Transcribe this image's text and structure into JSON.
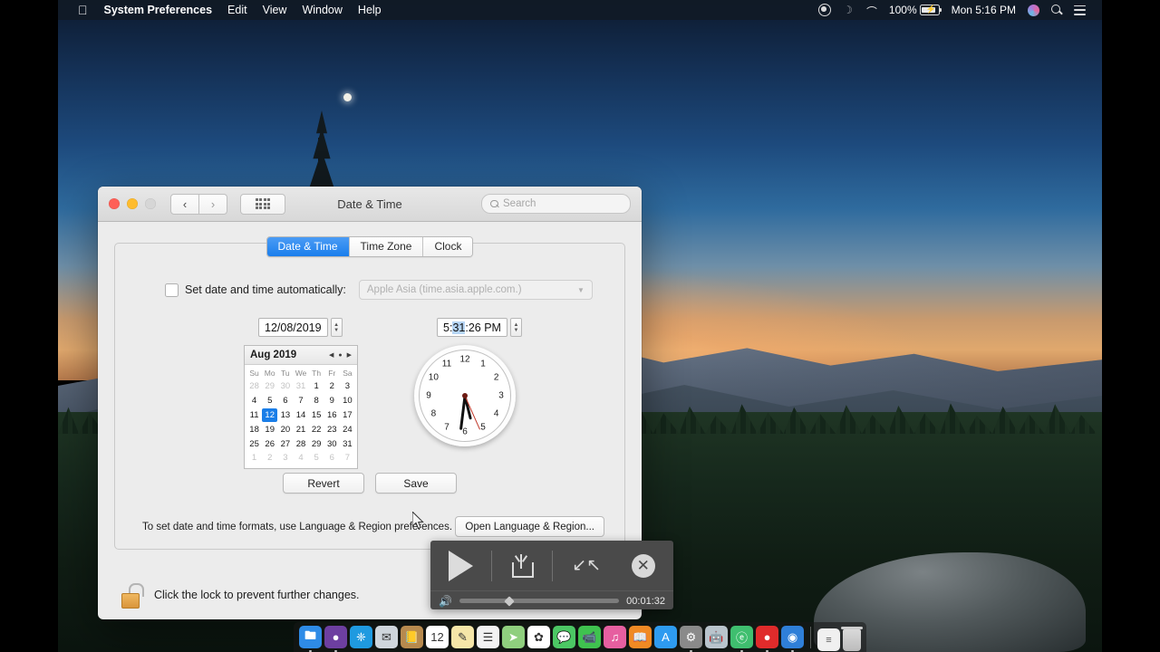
{
  "menubar": {
    "apple_logo": "",
    "items": [
      "System Preferences",
      "Edit",
      "View",
      "Window",
      "Help"
    ],
    "status": {
      "record_icon": "record-icon",
      "bluetooth_icon": "bluetooth-icon",
      "wifi_icon": "wifi-icon",
      "battery_percent": "100%",
      "clock": "Mon 5:16 PM",
      "siri_icon": "siri-icon",
      "search_icon": "spotlight-search-icon",
      "notification_icon": "notification-center-icon"
    }
  },
  "window": {
    "title": "Date & Time",
    "traffic_lights": [
      "close",
      "minimize",
      "zoom"
    ],
    "back_label": "‹",
    "forward_label": "›",
    "grid_button": "show-all-button",
    "search_placeholder": "Search",
    "tabs": [
      {
        "label": "Date & Time",
        "active": true
      },
      {
        "label": "Time Zone",
        "active": false
      },
      {
        "label": "Clock",
        "active": false
      }
    ],
    "auto_checkbox": {
      "label": "Set date and time automatically:",
      "checked": false,
      "server": "Apple Asia (time.asia.apple.com.)"
    },
    "date_field": {
      "value": "12/08/2019"
    },
    "time_field": {
      "prefix": "5:",
      "selected": "31",
      "suffix": ":26 PM"
    },
    "calendar": {
      "title": "Aug 2019",
      "weekdays": [
        "Su",
        "Mo",
        "Tu",
        "We",
        "Th",
        "Fr",
        "Sa"
      ],
      "selected_day": 12,
      "days": [
        {
          "n": "28",
          "mute": true
        },
        {
          "n": "29",
          "mute": true
        },
        {
          "n": "30",
          "mute": true
        },
        {
          "n": "31",
          "mute": true
        },
        {
          "n": "1"
        },
        {
          "n": "2"
        },
        {
          "n": "3"
        },
        {
          "n": "4"
        },
        {
          "n": "5"
        },
        {
          "n": "6"
        },
        {
          "n": "7"
        },
        {
          "n": "8"
        },
        {
          "n": "9"
        },
        {
          "n": "10"
        },
        {
          "n": "11"
        },
        {
          "n": "12",
          "sel": true
        },
        {
          "n": "13"
        },
        {
          "n": "14"
        },
        {
          "n": "15"
        },
        {
          "n": "16"
        },
        {
          "n": "17"
        },
        {
          "n": "18"
        },
        {
          "n": "19"
        },
        {
          "n": "20"
        },
        {
          "n": "21"
        },
        {
          "n": "22"
        },
        {
          "n": "23"
        },
        {
          "n": "24"
        },
        {
          "n": "25"
        },
        {
          "n": "26"
        },
        {
          "n": "27"
        },
        {
          "n": "28"
        },
        {
          "n": "29"
        },
        {
          "n": "30"
        },
        {
          "n": "31"
        },
        {
          "n": "1",
          "mute": true
        },
        {
          "n": "2",
          "mute": true
        },
        {
          "n": "3",
          "mute": true
        },
        {
          "n": "4",
          "mute": true
        },
        {
          "n": "5",
          "mute": true
        },
        {
          "n": "6",
          "mute": true
        },
        {
          "n": "7",
          "mute": true
        }
      ],
      "prev_icon": "triangle-left-icon",
      "today_icon": "dot-icon",
      "next_icon": "triangle-right-icon"
    },
    "clock_face": {
      "numerals": [
        "12",
        "1",
        "2",
        "3",
        "4",
        "5",
        "6",
        "7",
        "8",
        "9",
        "10",
        "11"
      ],
      "hour_deg": 166,
      "minute_deg": 187,
      "second_deg": 156
    },
    "revert_label": "Revert",
    "save_label": "Save",
    "format_note": "To set date and time formats, use Language & Region preferences.",
    "format_button": "Open Language & Region...",
    "lock_text": "Click the lock to prevent further changes.",
    "lock_icon": "unlocked-padlock-icon"
  },
  "video_overlay": {
    "play_icon": "play-icon",
    "share_icon": "share-icon",
    "shrink_icon": "collapse-icon",
    "close_icon": "close-circle-icon",
    "volume_icon": "volume-icon",
    "time": "00:01:32",
    "progress_percent": 29
  },
  "dock": {
    "items": [
      {
        "name": "finder",
        "color": "#2e8be6",
        "glyph": "🖿",
        "running": true
      },
      {
        "name": "siri",
        "color": "#6d3fa0",
        "glyph": "●",
        "running": true
      },
      {
        "name": "safari",
        "color": "#1f9ae0",
        "glyph": "❈",
        "running": false
      },
      {
        "name": "mail",
        "color": "#cfd6dc",
        "glyph": "✉",
        "running": false
      },
      {
        "name": "contacts",
        "color": "#b78a4e",
        "glyph": "📒",
        "running": false
      },
      {
        "name": "calendar",
        "color": "#ffffff",
        "glyph": "12",
        "running": false
      },
      {
        "name": "notes",
        "color": "#f5e6a8",
        "glyph": "✎",
        "running": false
      },
      {
        "name": "reminders",
        "color": "#f2f2f2",
        "glyph": "☰",
        "running": false
      },
      {
        "name": "maps",
        "color": "#8fcf7e",
        "glyph": "➤",
        "running": false
      },
      {
        "name": "photos",
        "color": "#ffffff",
        "glyph": "✿",
        "running": false
      },
      {
        "name": "messages",
        "color": "#4cc764",
        "glyph": "💬",
        "running": false
      },
      {
        "name": "facetime",
        "color": "#3fc24f",
        "glyph": "📹",
        "running": false
      },
      {
        "name": "itunes",
        "color": "#e65fa0",
        "glyph": "♫",
        "running": false
      },
      {
        "name": "ibooks",
        "color": "#f08a24",
        "glyph": "📖",
        "running": false
      },
      {
        "name": "app-store",
        "color": "#2e9bf0",
        "glyph": "A",
        "running": false
      },
      {
        "name": "system-preferences",
        "color": "#8a8a8a",
        "glyph": "⚙",
        "running": true
      },
      {
        "name": "automator",
        "color": "#b9c4cc",
        "glyph": "🤖",
        "running": false
      },
      {
        "name": "green-app",
        "color": "#3fbf6f",
        "glyph": "ⓔ",
        "running": true
      },
      {
        "name": "red-app",
        "color": "#e02b2b",
        "glyph": "●",
        "running": true
      },
      {
        "name": "blue-app",
        "color": "#2f7fd8",
        "glyph": "◉",
        "running": true
      }
    ],
    "document_name": "document-stack",
    "trash_name": "trash"
  }
}
